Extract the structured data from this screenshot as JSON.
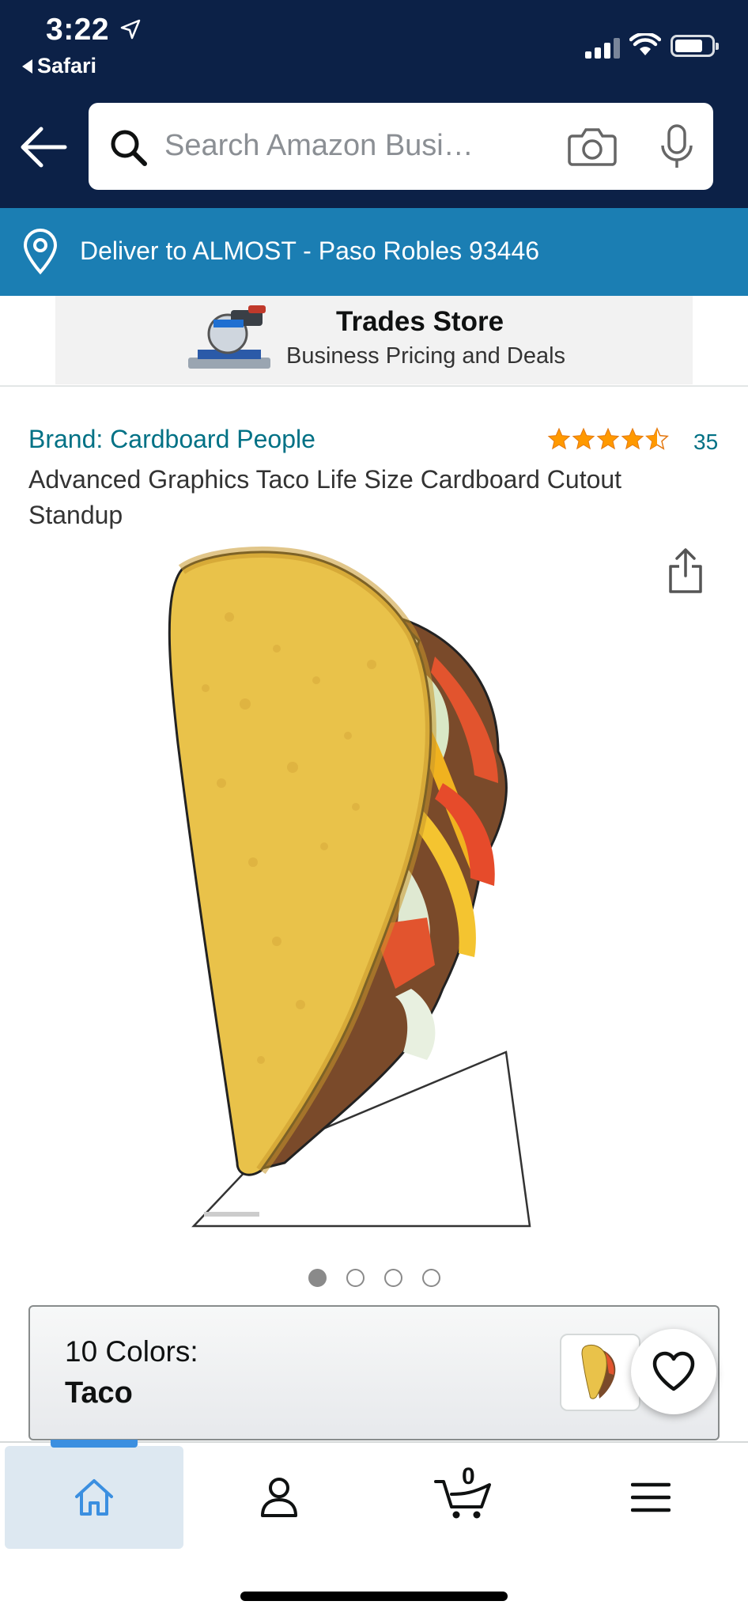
{
  "status_bar": {
    "time": "3:22",
    "back_app": "Safari"
  },
  "search": {
    "placeholder": "Search Amazon Busi…"
  },
  "delivery": {
    "text": "Deliver to ALMOST - Paso Robles 93446"
  },
  "banner": {
    "title": "Trades Store",
    "subtitle": "Business Pricing and Deals"
  },
  "product": {
    "brand": "Brand: Cardboard People",
    "rating": 4.5,
    "rating_count": "35",
    "title": "Advanced Graphics Taco Life Size Cardboard Cutout Standup",
    "image_count": 4,
    "active_image": 1
  },
  "colors": {
    "label": "10 Colors:",
    "selected": "Taco"
  },
  "tabbar": {
    "items": [
      {
        "name": "home",
        "icon": "home-icon",
        "active": true
      },
      {
        "name": "account",
        "icon": "person-icon",
        "active": false
      },
      {
        "name": "cart",
        "icon": "cart-icon",
        "active": false
      },
      {
        "name": "menu",
        "icon": "hamburger-menu-icon",
        "active": false
      }
    ],
    "cart_count": "0"
  },
  "colors_theme": {
    "header_bg": "#0c2147",
    "deliver_bg": "#1b7eb3",
    "link": "#007185",
    "star": "#ff9900",
    "active_tab": "#dde8f1"
  }
}
